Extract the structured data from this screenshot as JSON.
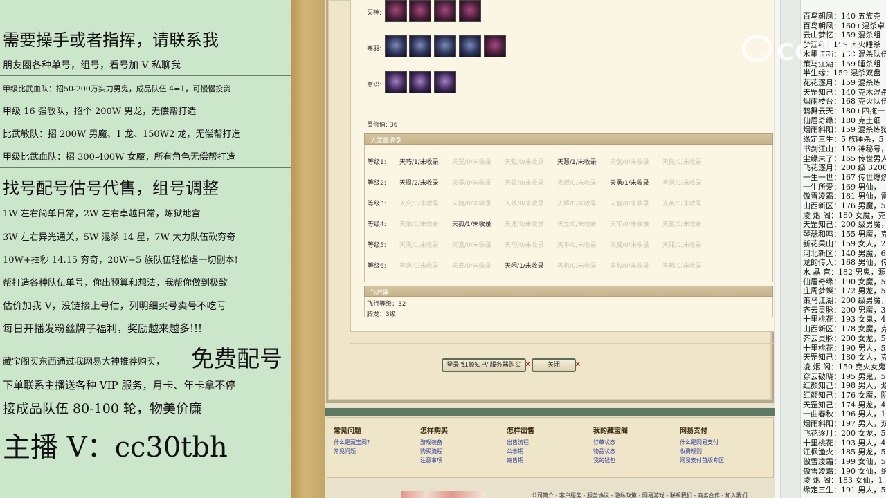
{
  "left_panel": {
    "lines": [
      "需要操手或者指挥，请联系我",
      "朋友圈各种单号，组号，看号加 V 私聊我",
      "甲级比武血队：招50-200万实力男鬼，成品队伍 4=1，可慢慢投资",
      "甲级 16 强敏队，招个 200W 男龙，无偿帮打造",
      "比武敏队：招 200W 男魔、1 龙、150W2 龙，无偿帮打造",
      "甲级比武血队：招 300-400W 女魔，所有角色无偿帮打造",
      "找号配号估号代售，组号调整",
      "1W 左右简单日常，2W 左右卓越日常，炼狱地宫",
      "3W 左右异光通关，5W 混杀 14 星，7W 大力队伍砍穷奇",
      "10W+抽秒 14.15 穷奇，20W+5 族队伍轻松虐一切副本!",
      "帮打造各种队伍单号，你出预算和想法，我帮你做到极致",
      "估价加我 V，没链接上号估，列明细买号卖号不吃亏",
      "每日开播发粉丝牌子福利，奖励越来越多!!!",
      "藏宝阁买东西通过我网易大神推荐购买，",
      "免费配号",
      "下单联系主播送各种 VIP 服务，月卡、年卡拿不停",
      "接成品队伍 80-100 轮，物美价廉",
      "主播 V：cc30tbh"
    ]
  },
  "equipment": {
    "rows": [
      {
        "label": "灭神:",
        "count": 4
      },
      {
        "label": "寒羽:",
        "count": 5
      },
      {
        "label": "意识:",
        "count": 3
      }
    ],
    "spirit_label": "灵修值: 36"
  },
  "tianjun": {
    "title": "天罡星收录",
    "tiers": [
      {
        "label": "等级1:",
        "cells": [
          {
            "t": "天巧/1/未收录",
            "on": true
          },
          {
            "t": "天罡/0/未收录",
            "on": false
          },
          {
            "t": "天魁/0/未收录",
            "on": false
          },
          {
            "t": "天慧/1/未收录",
            "on": true
          },
          {
            "t": "天剑/0/未收录",
            "on": false
          },
          {
            "t": "天微/0/未收录",
            "on": false
          }
        ]
      },
      {
        "label": "等级2:",
        "cells": [
          {
            "t": "天损/2/未收录",
            "on": true
          },
          {
            "t": "天暴/0/未收录",
            "on": false
          },
          {
            "t": "天猛/0/未收录",
            "on": false
          },
          {
            "t": "天威/0/未收录",
            "on": false
          },
          {
            "t": "天勇/1/未收录",
            "on": true
          },
          {
            "t": "天退/0/未收录",
            "on": false
          }
        ]
      },
      {
        "label": "等级3:",
        "cells": [
          {
            "t": "天究/0/未收录",
            "on": false
          },
          {
            "t": "天捷/0/未收录",
            "on": false
          },
          {
            "t": "天杀/0/未收录",
            "on": false
          },
          {
            "t": "天辉/0/未收录",
            "on": false
          },
          {
            "t": "天智/0/未收录",
            "on": false
          },
          {
            "t": "天英/0/未收录",
            "on": false
          }
        ]
      },
      {
        "label": "等级4:",
        "cells": [
          {
            "t": "天佑/0/未收录",
            "on": false
          },
          {
            "t": "天孤/1/未收录",
            "on": true
          },
          {
            "t": "天速/0/未收录",
            "on": false
          },
          {
            "t": "天立/0/未收录",
            "on": false
          },
          {
            "t": "天牢/0/未收录",
            "on": false
          },
          {
            "t": "天富/0/未收录",
            "on": false
          }
        ]
      },
      {
        "label": "等级5:",
        "cells": [
          {
            "t": "天满/0/未收录",
            "on": false
          },
          {
            "t": "天富/0/未收录",
            "on": false
          },
          {
            "t": "天巧/0/未收录",
            "on": false
          },
          {
            "t": "天平/0/未收录",
            "on": false
          },
          {
            "t": "天威/0/未收录",
            "on": false
          },
          {
            "t": "天罪/0/未收录",
            "on": false
          }
        ]
      },
      {
        "label": "等级6:",
        "cells": [
          {
            "t": "天退/0/未收录",
            "on": false
          },
          {
            "t": "天寿/0/未收录",
            "on": false
          },
          {
            "t": "天闲/1/未收录",
            "on": true
          },
          {
            "t": "天机/0/未收录",
            "on": false
          },
          {
            "t": "天败/0/未收录",
            "on": false
          },
          {
            "t": "天魁/0/未收录",
            "on": false
          }
        ]
      }
    ]
  },
  "flight": {
    "title": "飞行器",
    "level": "飞行等级：32",
    "upgrade": "腾龙：3级"
  },
  "buttons": {
    "login_label": "登录\"红颜知己\"服务器购买",
    "close_label": "关闭",
    "x": "✕"
  },
  "footer": {
    "columns": [
      {
        "head": "常见问题",
        "links": [
          "什么是藏宝阁?",
          "常见问题"
        ]
      },
      {
        "head": "怎样购买",
        "links": [
          "游戏装备",
          "购买流程",
          "注意事项"
        ]
      },
      {
        "head": "怎样出售",
        "links": [
          "出售流程",
          "公示期",
          "寄售期"
        ]
      },
      {
        "head": "我的藏宝阁",
        "links": [
          "订单状态",
          "物品状态",
          "我的钱包"
        ]
      },
      {
        "head": "网易支付",
        "links": [
          "什么是网易支付",
          "收费规则",
          "网易支付首版专区"
        ]
      }
    ],
    "bottom_links": "公司简介 - 客户服务 - 服务协议 - 隐私政策 - 网易游戏 - 联系我们 - 商务合作 - 加入我们"
  },
  "right_list": [
    "百鸟朝凤：140 五族克",
    "百鸟朝凤：160+混杀卓",
    "云山梦忆：159 混杀组",
    "梦江红：159 克火睡杀",
    "水墨江南：150 混杀队伍",
    "策马江湖：159 睡杀组",
    "半生缘：159 混杀双盘",
    "花花逐月：159 混杀炼",
    "天罡知己：140 克木混杀",
    "烟雨楼台：168 克火队伍",
    "鹤舞云天：180+四拖一",
    "仙眉奇缘：180 克土细",
    "烟雨斜阳：159 混杀炼狱",
    "缘定三生：5 族睡杀，5",
    "书剑江山：159 神秘号，",
    "尘缘未了：165 传世男人",
    "飞花逐月：200 级 3200",
    "一生一世：167 传世燃烧",
    "一生所爱：169 男仙，",
    "傲雪凌霜：181 男仙，雷",
    "山西新区：176 男魔，5",
    "凌 烟 阁：180 女魔，克",
    "天罡知己：200 级男魔，",
    "琴瑟和鸣：155 男魔，克",
    "新花果山：159 女人，2",
    "河北新区：140 男魔，6",
    "龙的传人：168 男仙，传",
    "水 晶 宫：182 男鬼，源",
    "仙眉奇缘：190 女魔，5",
    "庄周梦蝶：172 男龙，5",
    "策马江湖：200 级男魔，",
    "齐云灵脉：200 男魔，3",
    "十里桃花：193 女鬼，4",
    "山西新区：178 女魔，克",
    "齐云灵脉：200 女龙，5",
    "十里桃花：190 男人，5",
    "天罡知己：180 女人，克",
    "凌 烟 阁：150 克火女鬼",
    "穿云破晓：195 男鬼，5",
    "红颜知己：198 男人，源",
    "红颜知己：176 女魔，阴",
    "天罡知己：174 男龙，4",
    "一曲春秋：196 男人，1",
    "烟雨斜阳：197 男人，双",
    "飞花逐月：200 女龙，5",
    "十里桃花：193 男人，4",
    "江枫渔火：185 男龙，5",
    "傲雪凌霜：199 女仙，5",
    "傲雪凌霜：190 女仙，绝",
    "凌 烟 阁：183 女仙，1",
    "缘定三生：191 男人，5"
  ],
  "watermark": "CC直播"
}
